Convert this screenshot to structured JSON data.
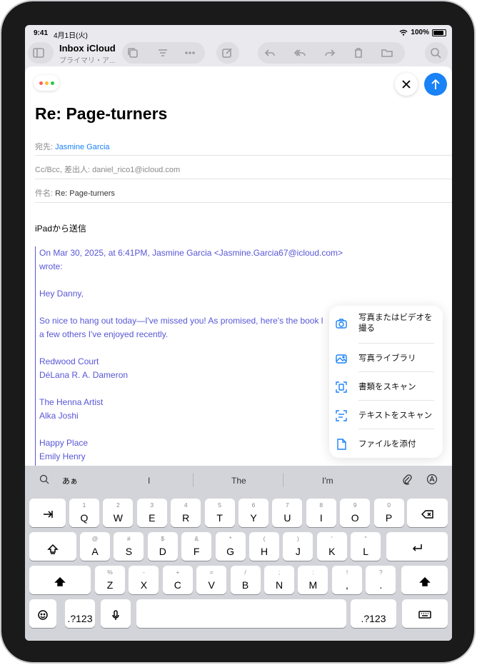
{
  "status": {
    "time": "9:41",
    "date": "4月1日(火)",
    "battery": "100%"
  },
  "mailbox": {
    "title": "Inbox iCloud",
    "subtitle": "プライマリ・ア..."
  },
  "compose": {
    "subject_title": "Re: Page-turners",
    "to_label": "宛先:",
    "to_value": "Jasmine Garcia",
    "cc_label": "Cc/Bcc, 差出人:",
    "cc_value": "daniel_rico1@icloud.com",
    "subject_label": "件名:",
    "subject_value": "Re: Page-turners",
    "signature": "iPadから送信"
  },
  "quote": {
    "header": "On Mar 30, 2025, at 6:41PM, Jasmine Garcia <Jasmine.Garcia67@icloud.com> wrote:",
    "greeting": "Hey Danny,",
    "para1_line1": "So nice to hang out today—I've missed you! As promised, here's the book l",
    "para1_line2": "a few others I've enjoyed recently.",
    "book1_title": "Redwood Court",
    "book1_author": "DéLana R. A. Dameron",
    "book2_title": "The Henna Artist",
    "book2_author": "Alka Joshi",
    "book3_title": "Happy Place",
    "book3_author": "Emily Henry"
  },
  "attach_menu": [
    {
      "icon": "camera-icon",
      "label_l1": "写真またはビデオを",
      "label_l2": "撮る"
    },
    {
      "icon": "photo-library-icon",
      "label_l1": "写真ライブラリ",
      "label_l2": ""
    },
    {
      "icon": "scan-document-icon",
      "label_l1": "書類をスキャン",
      "label_l2": ""
    },
    {
      "icon": "scan-text-icon",
      "label_l1": "テキストをスキャン",
      "label_l2": ""
    },
    {
      "icon": "file-icon",
      "label_l1": "ファイルを添付",
      "label_l2": ""
    }
  ],
  "keyboard": {
    "kana_toggle": "あぁ",
    "suggestions": [
      "I",
      "The",
      "I'm"
    ],
    "row1": [
      [
        "1",
        "Q"
      ],
      [
        "2",
        "W"
      ],
      [
        "3",
        "E"
      ],
      [
        "4",
        "R"
      ],
      [
        "5",
        "T"
      ],
      [
        "6",
        "Y"
      ],
      [
        "7",
        "U"
      ],
      [
        "8",
        "I"
      ],
      [
        "9",
        "O"
      ],
      [
        "0",
        "P"
      ]
    ],
    "row2": [
      [
        "@",
        "A"
      ],
      [
        "#",
        "S"
      ],
      [
        "$",
        "D"
      ],
      [
        "&",
        "F"
      ],
      [
        "*",
        "G"
      ],
      [
        "(",
        "H"
      ],
      [
        ")",
        "J"
      ],
      [
        "'",
        "K"
      ],
      [
        "\"",
        "L"
      ]
    ],
    "row3": [
      [
        "%",
        "Z"
      ],
      [
        "-",
        "X"
      ],
      [
        "+",
        "C"
      ],
      [
        "=",
        "V"
      ],
      [
        "/",
        "B"
      ],
      [
        ";",
        "N"
      ],
      [
        ":",
        "M"
      ]
    ],
    "row3_punct": [
      [
        "!",
        ","
      ],
      [
        "?",
        "."
      ]
    ],
    "num_key": ".?123"
  },
  "colors": {
    "accent": "#1a82f7",
    "quote": "#5856d6"
  }
}
